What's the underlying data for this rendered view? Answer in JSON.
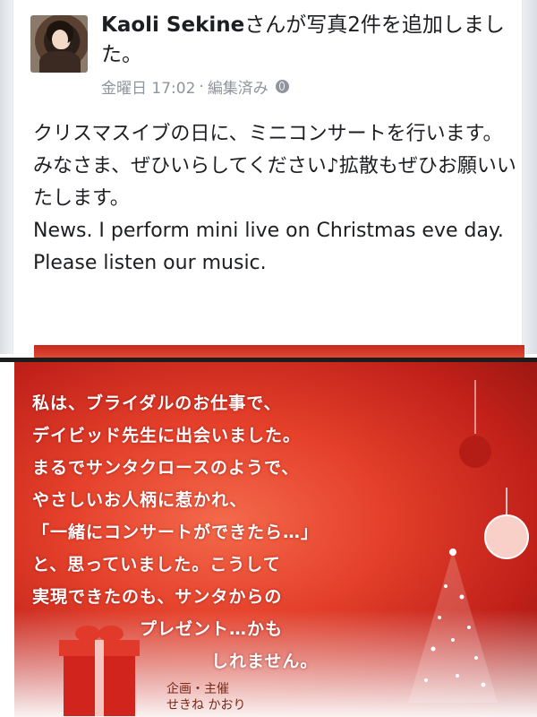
{
  "post": {
    "author": "Kaoli Sekine",
    "action": "さんが写真2件を追加しました。",
    "timestamp": "金曜日 17:02",
    "separator": "·",
    "edited": "編集済み",
    "audience_icon": "globe-icon",
    "body": [
      "クリスマスイブの日に、ミニコンサートを行います。",
      "みなさま、ぜひいらしてください♪拡散もぜひお願いいたします。",
      "News. I perform mini live on Christmas eve day.",
      "Please listen our music."
    ]
  },
  "photo": {
    "message_lines": [
      "私は、ブライダルのお仕事で、",
      "デイビッド先生に出会いました。",
      "まるでサンタクロースのようで、",
      "やさしいお人柄に惹かれ、",
      "「一緒にコンサートができたら…」",
      "と、思っていました。こうして",
      "実現できたのも、サンタからの",
      "プレゼント…かも",
      "しれません。"
    ],
    "credit_label": "企画・主催",
    "credit_name": "せきね かおり"
  },
  "colors": {
    "card_red": "#e5412b",
    "text_primary": "#1c1e21",
    "text_meta": "#90949c"
  }
}
